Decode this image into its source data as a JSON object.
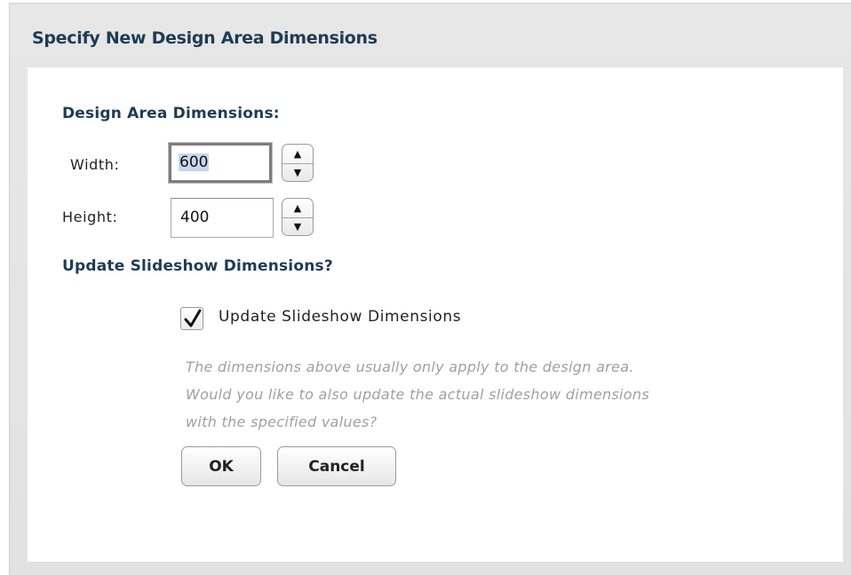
{
  "dialog": {
    "title": "Specify New Design Area Dimensions"
  },
  "design_area": {
    "heading": "Design Area Dimensions:",
    "width_label": "Width:",
    "width_value": "600",
    "height_label": "Height:",
    "height_value": "400"
  },
  "slideshow": {
    "heading": "Update Slideshow Dimensions?",
    "checkbox_label": "Update Slideshow Dimensions",
    "checkbox_checked": true,
    "help_lines": [
      "The dimensions above usually only apply to the design area.",
      "Would you like to also update the actual slideshow dimensions",
      "with the specified values?"
    ]
  },
  "buttons": {
    "ok_label": "OK",
    "cancel_label": "Cancel"
  },
  "spinner": {
    "up_glyph": "▲",
    "down_glyph": "▼"
  },
  "icons": {
    "checkmark": "check-icon"
  }
}
